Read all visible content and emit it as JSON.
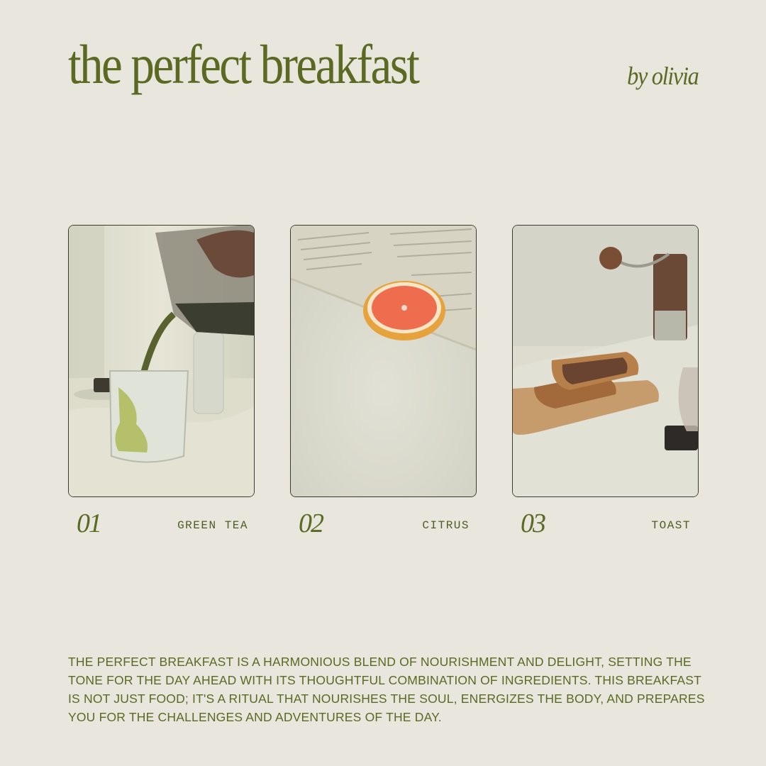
{
  "header": {
    "title": "the perfect breakfast",
    "byline": "by olivia"
  },
  "cards": [
    {
      "number": "01",
      "label": "GREEN TEA"
    },
    {
      "number": "02",
      "label": "CITRUS"
    },
    {
      "number": "03",
      "label": "TOAST"
    }
  ],
  "description": "THE PERFECT BREAKFAST IS A HARMONIOUS BLEND OF NOURISHMENT AND DELIGHT, SETTING THE TONE FOR THE DAY AHEAD WITH ITS THOUGHTFUL COMBINATION OF INGREDIENTS. THIS BREAKFAST IS NOT JUST FOOD; IT'S A RITUAL THAT NOURISHES THE SOUL, ENERGIZES THE BODY, AND PREPARES YOU FOR THE CHALLENGES AND ADVENTURES OF THE DAY.",
  "colors": {
    "background": "#e9e6de",
    "accent": "#5b6a22"
  }
}
